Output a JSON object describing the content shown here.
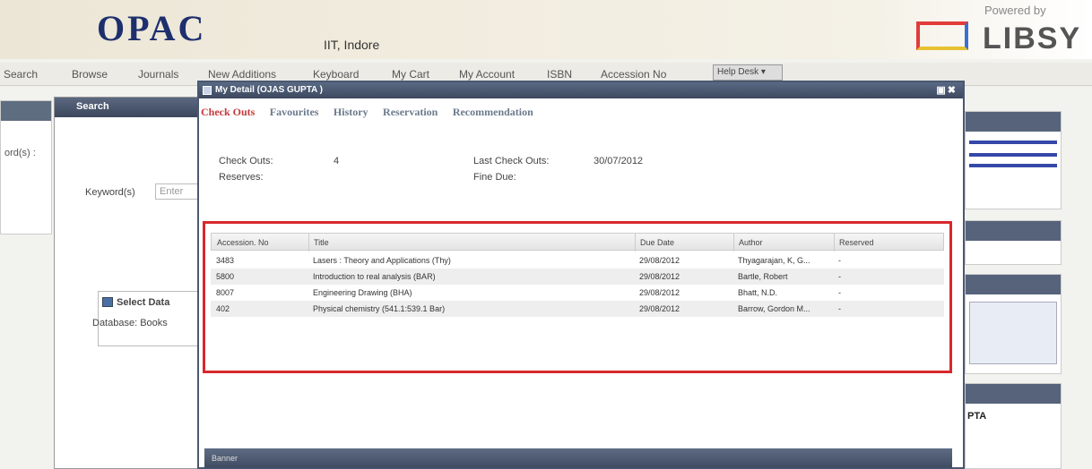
{
  "header": {
    "brand": "OPAC",
    "institution": "IIT, Indore",
    "powered_by": "Powered by",
    "vendor_logo_text": "LIBSY"
  },
  "nav": {
    "items": [
      "Search",
      "Browse",
      "Journals",
      "New Additions",
      "Keyboard",
      "My Cart",
      "My Account",
      "ISBN",
      "Accession No"
    ],
    "help_desk": "Help Desk ▾"
  },
  "left_panel": {
    "label": "ord(s) :"
  },
  "search_window": {
    "title": "Search",
    "keyword_label": "Keyword(s)",
    "keyword_placeholder": "Enter",
    "select_db_title": "Select Data",
    "database_label": "Database: Books"
  },
  "right_panels": {
    "user_fragment": "PTA"
  },
  "dialog": {
    "title": "My Detail (OJAS GUPTA )",
    "tabs": [
      "Check Outs",
      "Favourites",
      "History",
      "Reservation",
      "Recommendation"
    ],
    "active_tab": "Check Outs",
    "summary": {
      "checkouts_label": "Check Outs:",
      "checkouts_value": "4",
      "reserves_label": "Reserves:",
      "last_checkout_label": "Last Check Outs:",
      "last_checkout_value": "30/07/2012",
      "fine_due_label": "Fine Due:"
    },
    "table": {
      "columns": [
        "Accession. No",
        "Title",
        "Due Date",
        "Author",
        "Reserved"
      ],
      "rows": [
        {
          "accession": "3483",
          "title": "Lasers : Theory and Applications (Thy)",
          "due": "29/08/2012",
          "author": "Thyagarajan, K, G...",
          "reserved": "-"
        },
        {
          "accession": "5800",
          "title": "Introduction to real analysis (BAR)",
          "due": "29/08/2012",
          "author": "Bartle, Robert",
          "reserved": "-"
        },
        {
          "accession": "8007",
          "title": "Engineering Drawing (BHA)",
          "due": "29/08/2012",
          "author": "Bhatt, N.D.",
          "reserved": "-"
        },
        {
          "accession": "402",
          "title": "Physical chemistry (541.1:539.1 Bar)",
          "due": "29/08/2012",
          "author": "Barrow, Gordon M...",
          "reserved": "-"
        }
      ]
    },
    "footer": "Banner"
  },
  "colors": {
    "brand_blue": "#1e2f6e",
    "active_tab": "#c53a3a",
    "highlight_border": "#d8282c",
    "titlebar": "#3b485e"
  }
}
